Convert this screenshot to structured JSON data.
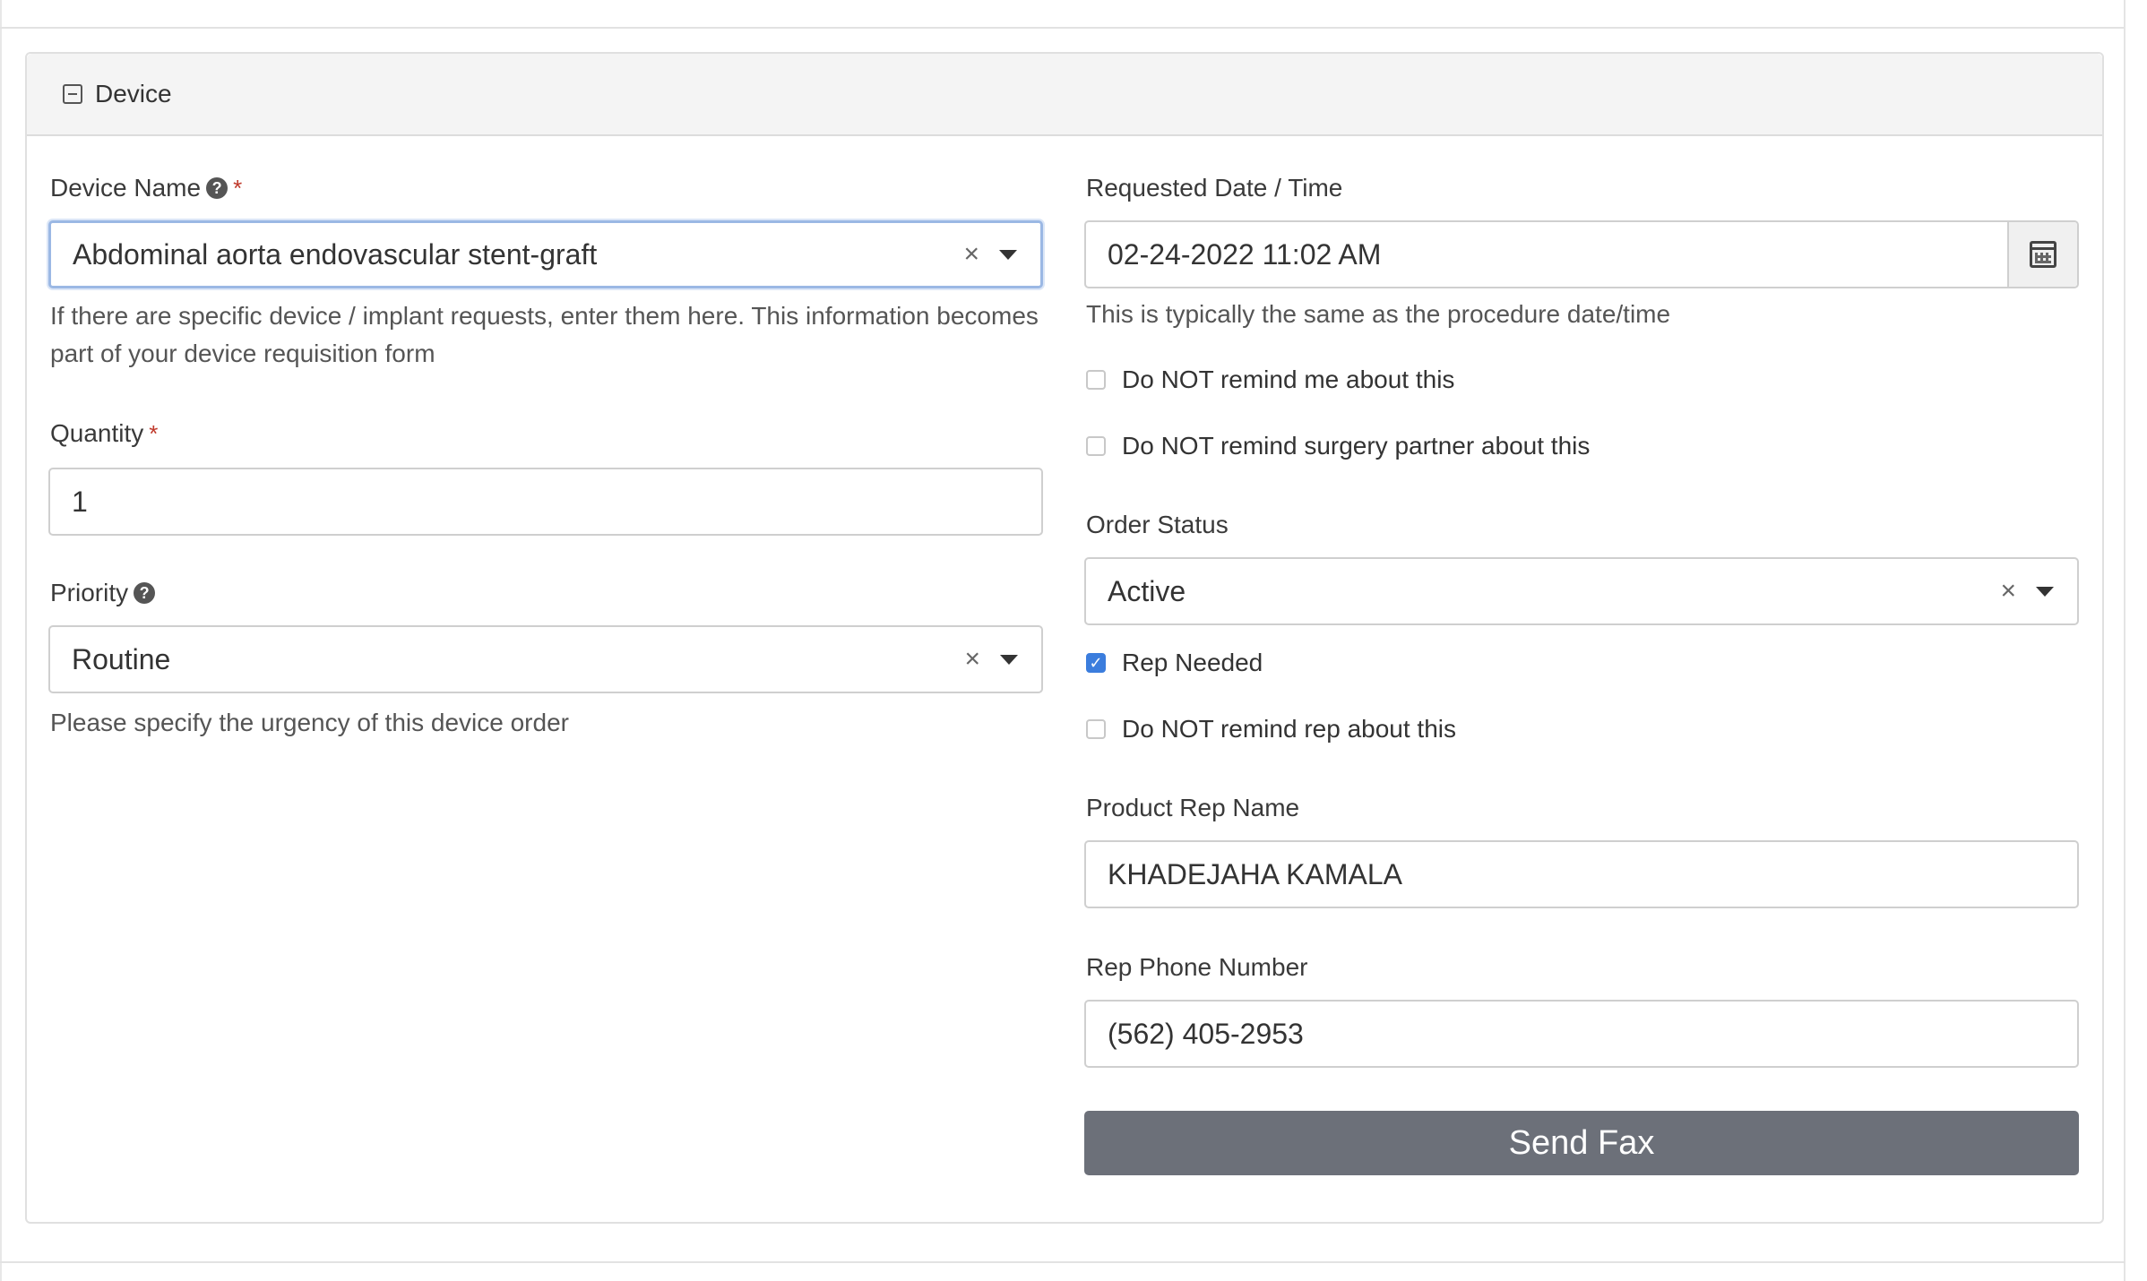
{
  "panel": {
    "title": "Device"
  },
  "left": {
    "device_name": {
      "label": "Device Name",
      "value": "Abdominal aorta endovascular stent-graft",
      "help_line1": "If there are specific device / implant requests, enter them here. This information becomes",
      "help_line2": "part of your device requisition form"
    },
    "quantity": {
      "label": "Quantity",
      "value": "1"
    },
    "priority": {
      "label": "Priority",
      "value": "Routine",
      "help": "Please specify the urgency of this device order"
    }
  },
  "right": {
    "requested_date": {
      "label": "Requested Date / Time",
      "value": "02-24-2022 11:02 AM",
      "help": "This is typically the same as the procedure date/time"
    },
    "remind_me": {
      "label": "Do NOT remind me about this",
      "checked": false
    },
    "remind_partner": {
      "label": "Do NOT remind surgery partner about this",
      "checked": false
    },
    "order_status": {
      "label": "Order Status",
      "value": "Active"
    },
    "rep_needed": {
      "label": "Rep Needed",
      "checked": true
    },
    "remind_rep": {
      "label": "Do NOT remind rep about this",
      "checked": false
    },
    "rep_name": {
      "label": "Product Rep Name",
      "value": "KHADEJAHA KAMALA"
    },
    "rep_phone": {
      "label": "Rep Phone Number",
      "value": "(562) 405-2953"
    },
    "send_fax": {
      "label": "Send Fax"
    }
  },
  "symbols": {
    "required": "*",
    "help": "?",
    "clear": "×",
    "check": "✓"
  },
  "colors": {
    "accent": "#3b7ddd",
    "focus_border": "#9bb8e4",
    "button": "#6c7079",
    "required": "#c0392b"
  }
}
